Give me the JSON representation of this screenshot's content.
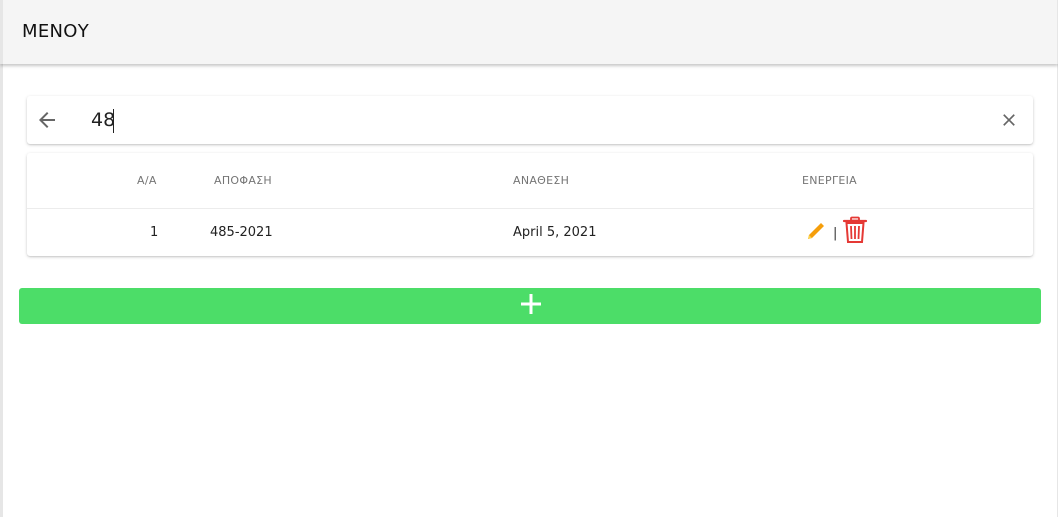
{
  "header": {
    "title": "ΜΕΝΟΥ"
  },
  "search": {
    "value": "48",
    "back_icon": "arrow-left-icon",
    "clear_icon": "close-icon"
  },
  "table": {
    "columns": [
      "Α/Α",
      "ΑΠΟΦΑΣΗ",
      "ΑΝΑΘΕΣΗ",
      "ΕΝΕΡΓΕΙΑ"
    ],
    "rows": [
      {
        "index": "1",
        "decision": "485-2021",
        "assignment": "April 5, 2021",
        "separator": "|"
      }
    ],
    "actions": {
      "edit_icon": "pencil-icon",
      "delete_icon": "trash-icon"
    }
  },
  "add_button": {
    "label": "+",
    "icon": "plus-icon"
  },
  "colors": {
    "header_bg": "#f5f5f5",
    "add_button": "#4cdd68",
    "edit_icon": "#f59e0b",
    "delete_icon": "#e53935"
  }
}
